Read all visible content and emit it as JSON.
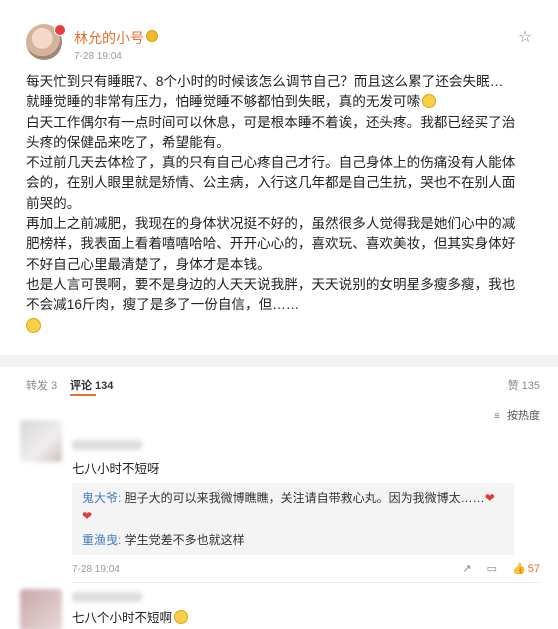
{
  "post": {
    "username": "林允的小号",
    "time": "7-28 19:04",
    "lines": [
      "每天忙到只有睡眠7、8个小时的时候该怎么调节自己？而且这么累了还会失眠…",
      "就睡觉睡的非常有压力，怕睡觉睡不够都怕到失眠，真的无发可嗦",
      "白天工作偶尔有一点时间可以休息，可是根本睡不着诶，还头疼。我都已经买了治头疼的保健品来吃了，希望能有。",
      "不过前几天去体检了，真的只有自己心疼自己才行。自己身体上的伤痛没有人能体会的，在别人眼里就是矫情、公主病，入行这几年都是自己生抗，哭也不在别人面前哭的。",
      "再加上之前减肥，我现在的身体状况挺不好的，虽然很多人觉得我是她们心中的减肥榜样，我表面上看着嘻嘻哈哈、开开心心的，喜欢玩、喜欢美妆，但其实身体好不好自己心里最清楚了，身体才是本钱。",
      "也是人言可畏啊，要不是身边的人天天说我胖，天天说别的女明星多瘦多瘦，我也不会减16斤肉，瘦了是多了一份自信，但……"
    ]
  },
  "tabs": {
    "repost": "转发 3",
    "comment": "评论 134",
    "like": "赞 135"
  },
  "sort_label": "按热度",
  "comments": [
    {
      "text": "七八小时不短呀",
      "replies": [
        {
          "name": "鬼大爷:",
          "text": " 胆子大的可以来我微博瞧瞧，关注请自带救心丸。因为我微博太……"
        },
        {
          "name": "重渔曳:",
          "text": " 学生党差不多也就这样"
        }
      ],
      "time": "7-28 19:04",
      "likes": "57"
    },
    {
      "text": "七八个小时不短啊"
    }
  ]
}
